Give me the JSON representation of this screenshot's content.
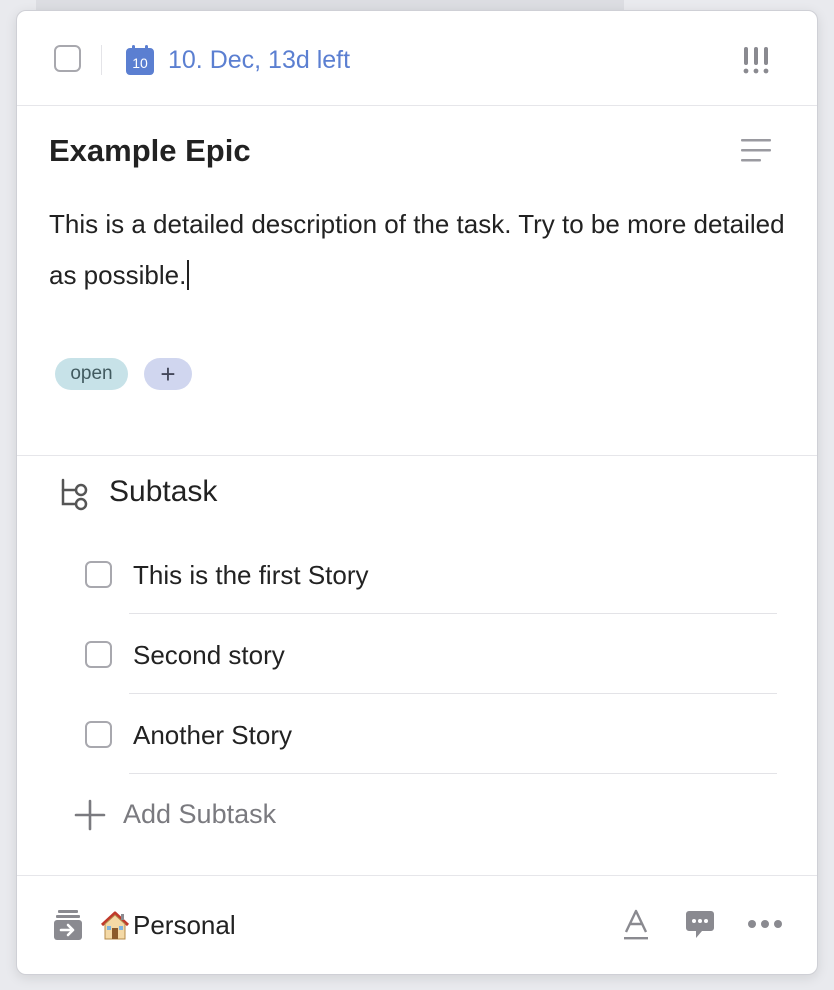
{
  "header": {
    "calendar_day": "10",
    "due_date": "10. Dec, 13d left",
    "icons": {
      "calendar": "calendar-icon",
      "priority": "priority-icon"
    }
  },
  "task": {
    "title": "Example Epic",
    "description": "This is a detailed description of the task. Try to be more detailed as possible."
  },
  "tags": {
    "items": [
      "open"
    ],
    "add_label": "+"
  },
  "subtasks": {
    "heading": "Subtask",
    "items": [
      {
        "label": "This is the first Story",
        "checked": false
      },
      {
        "label": "Second story",
        "checked": false
      },
      {
        "label": "Another Story",
        "checked": false
      }
    ],
    "add_label": "Add Subtask"
  },
  "footer": {
    "project_name": "Personal",
    "project_icon": "house-emoji-icon",
    "icons": [
      "move-to-inbox-icon",
      "text-format-icon",
      "comment-icon",
      "more-icon"
    ]
  },
  "colors": {
    "accent_blue": "#5b7fd1",
    "tag_open_bg": "#c7e2e8",
    "tag_add_bg": "#d0d6ef",
    "text": "#222222",
    "muted": "#7a7a7f"
  }
}
